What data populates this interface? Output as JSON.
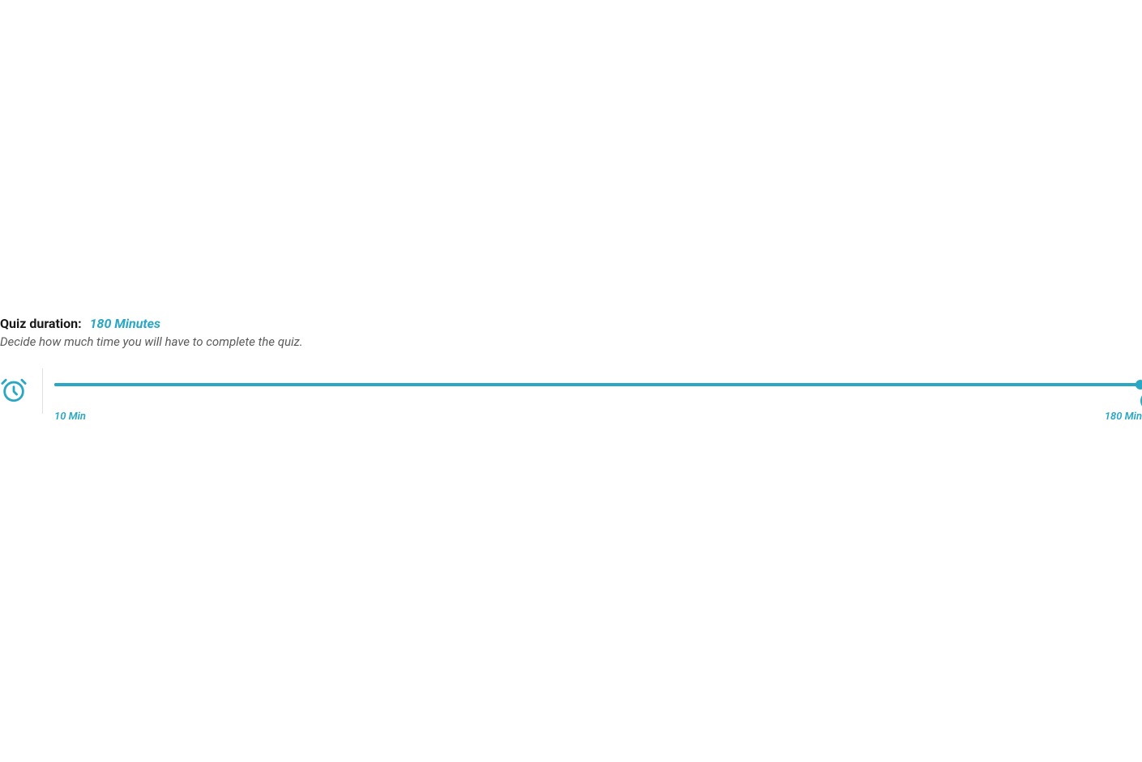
{
  "quizDuration": {
    "label": "Quiz duration:",
    "value": "180 Minutes",
    "description": "Decide how much time you will have to complete the quiz.",
    "slider": {
      "minLabel": "10 Min",
      "maxLabel": "180 Min",
      "min": 10,
      "max": 180,
      "current": 180
    }
  },
  "colors": {
    "accent": "#29a7c4"
  }
}
